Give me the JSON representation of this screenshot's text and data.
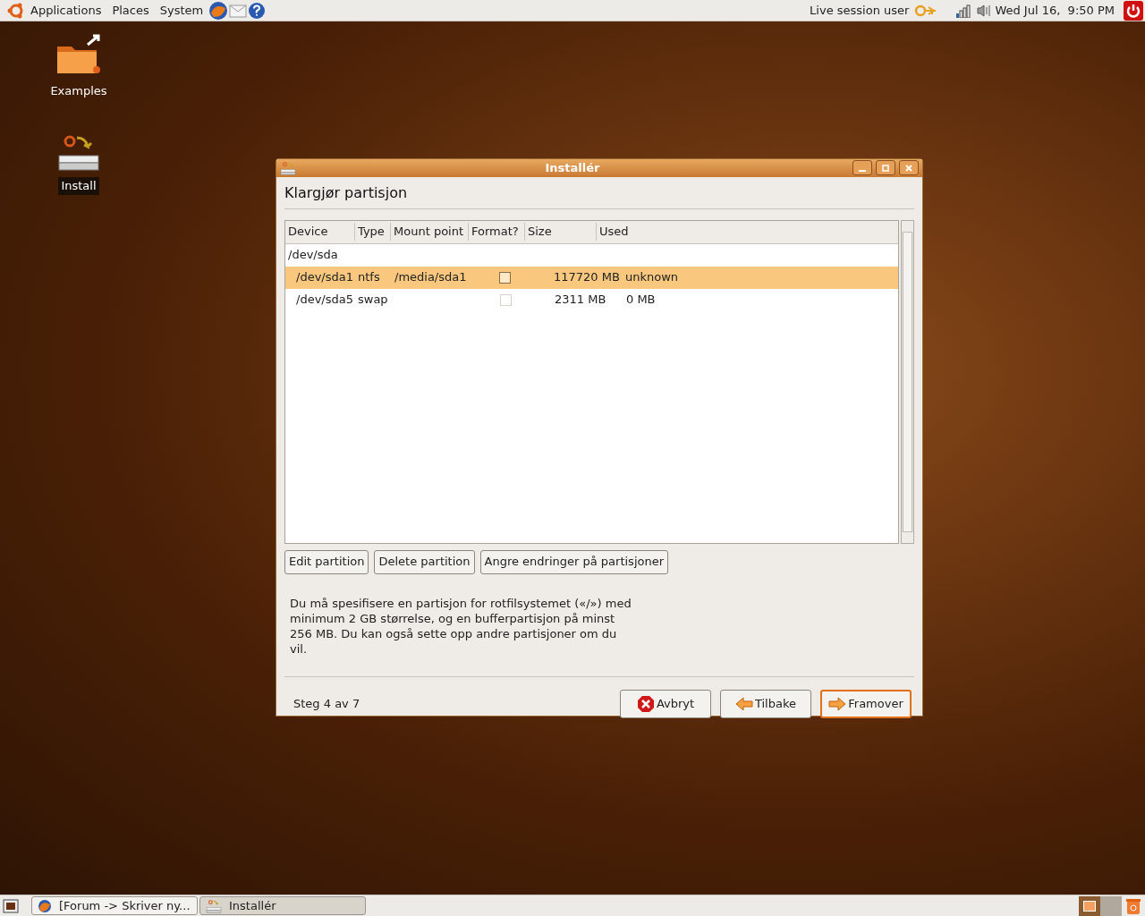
{
  "top_panel": {
    "menus": [
      "Applications",
      "Places",
      "System"
    ],
    "user": "Live session user",
    "clock": "Wed Jul 16,  9:50 PM"
  },
  "desktop_icons": [
    {
      "label": "Examples",
      "kind": "folder",
      "selected": false
    },
    {
      "label": "Install",
      "kind": "installer",
      "selected": true
    }
  ],
  "window": {
    "title": "Installér",
    "heading": "Klargjør partisjon",
    "table": {
      "columns": [
        "Device",
        "Type",
        "Mount point",
        "Format?",
        "Size",
        "Used"
      ],
      "rows": [
        {
          "device": "/dev/sda",
          "selected": false,
          "children": [
            {
              "device": "/dev/sda1",
              "type": "ntfs",
              "mount_point": "/media/sda1",
              "format": false,
              "format_enabled": true,
              "size": "117720 MB",
              "used": "unknown",
              "selected": true
            },
            {
              "device": "/dev/sda5",
              "type": "swap",
              "format": false,
              "format_enabled": false,
              "size": "2311 MB",
              "used": "0 MB",
              "selected": false
            }
          ]
        }
      ]
    },
    "partition_buttons": [
      "Edit partition",
      "Delete partition",
      "Angre endringer på partisjoner"
    ],
    "info": "Du må spesifisere en partisjon for rotfilsystemet («/») med minimum 2 GB størrelse, og en bufferpartisjon på minst 256 MB. Du kan også sette opp andre partisjoner om du vil.",
    "step": "Steg 4 av 7",
    "buttons": [
      {
        "label": "Avbryt",
        "kind": "cancel",
        "default": false
      },
      {
        "label": "Tilbake",
        "kind": "back",
        "default": false
      },
      {
        "label": "Framover",
        "kind": "forward",
        "default": true
      }
    ]
  },
  "taskbar": {
    "tasks": [
      {
        "label": "[Forum -> Skriver ny...",
        "kind": "browser",
        "selected": false
      },
      {
        "label": "Installér",
        "kind": "installer",
        "selected": true
      }
    ],
    "workspaces": [
      {
        "selected": true
      },
      {
        "selected": false
      }
    ]
  }
}
